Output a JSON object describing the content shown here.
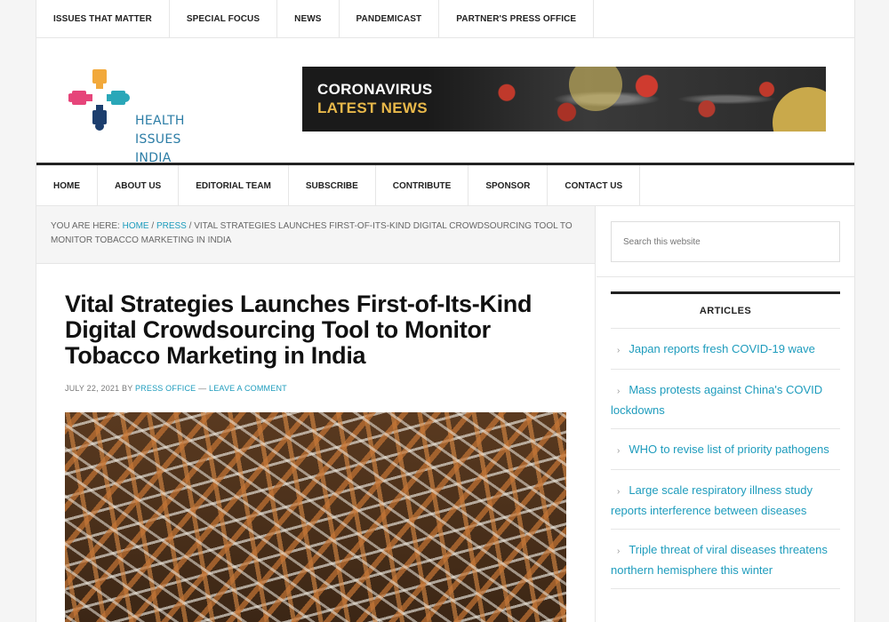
{
  "top_nav": [
    "ISSUES THAT MATTER",
    "SPECIAL FOCUS",
    "NEWS",
    "PANDEMICAST",
    "PARTNER'S PRESS OFFICE"
  ],
  "logo": {
    "line1": "HEALTH",
    "line2": "ISSUES",
    "line3": "INDIA",
    "colors": [
      "#f2a93b",
      "#e6457a",
      "#2aa7b8",
      "#1c3e6e"
    ]
  },
  "banner": {
    "line1": "CORONAVIRUS",
    "line2": "LATEST NEWS"
  },
  "main_nav": [
    "HOME",
    "ABOUT US",
    "EDITORIAL TEAM",
    "SUBSCRIBE",
    "CONTRIBUTE",
    "SPONSOR",
    "CONTACT US"
  ],
  "breadcrumb": {
    "prefix": "YOU ARE HERE:",
    "home": "HOME",
    "sep1": "/",
    "section": "PRESS",
    "sep2": "/",
    "current": "VITAL STRATEGIES LAUNCHES FIRST-OF-ITS-KIND DIGITAL CROWDSOURCING TOOL TO MONITOR TOBACCO MARKETING IN INDIA"
  },
  "article": {
    "title": "Vital Strategies Launches First-of-Its-Kind Digital Crowdsourcing Tool to Monitor Tobacco Marketing in India",
    "date": "JULY 22, 2021",
    "by": "BY",
    "author": "PRESS OFFICE",
    "dash": "—",
    "comment": "LEAVE A COMMENT"
  },
  "search": {
    "placeholder": "Search this website"
  },
  "sidebar": {
    "widget_title": "ARTICLES",
    "articles": [
      "Japan reports fresh COVID-19 wave",
      "Mass protests against China's COVID lockdowns",
      "WHO to revise list of priority pathogens",
      "Large scale respiratory illness study reports interference between diseases",
      "Triple threat of viral diseases threatens northern hemisphere this winter"
    ]
  },
  "colors": {
    "link": "#1e9cbd",
    "text": "#111111",
    "logo_text": "#2c7da6"
  }
}
